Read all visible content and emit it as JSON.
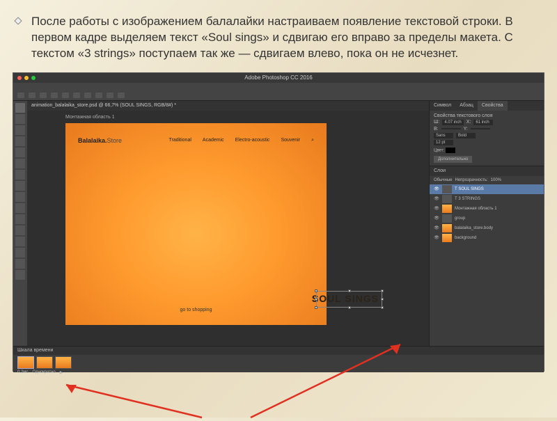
{
  "slide": {
    "bullet_text": "После работы с изображением балалайки настраиваем появление текстовой строки. В первом кадре выделяем текст «Soul sings» и сдвигаю его вправо за пределы макета. С текстом «3 strings» поступаем так же — сдвигаем влево, пока он не исчезнет."
  },
  "photoshop": {
    "title": "Adobe Photoshop CC 2016",
    "document_tab": "animation_balalaika_store.psd @ 66,7% (SOUL SINGS, RGB/8#) *",
    "artboard_label": "Монтажная область 1",
    "canvas": {
      "brand_main": "Balalaika.",
      "brand_sub": "Store",
      "nav": [
        "Traditional",
        "Academic",
        "Electro-acoustic",
        "Souvenir"
      ],
      "cta": "go to shopping",
      "hero_text": "SOUL SINGS"
    },
    "right_panels": {
      "tabs": [
        "Символ",
        "Абзац",
        "Свойства"
      ],
      "active_tab": "Свойства",
      "panel_title": "Свойства текстового слоя",
      "width_label": "Ш:",
      "width_val": "4.07 inch",
      "height_label": "В:",
      "x_label": "X:",
      "x_val": "61 inch",
      "y_label": "Y:",
      "font": "Sans",
      "weight": "Bold",
      "size": "12 pt",
      "btn": "Дополнительно"
    },
    "layers": {
      "title": "Слои",
      "mode": "Обычные",
      "opacity_label": "Непрозрачность:",
      "opacity": "100%",
      "items": [
        {
          "name": "Т SOUL SINGS",
          "selected": true
        },
        {
          "name": "Т 3 STRINGS",
          "selected": false
        },
        {
          "name": "Монтажная область 1",
          "selected": false
        },
        {
          "name": "group",
          "selected": false
        },
        {
          "name": "balalaika_store.body",
          "selected": false
        },
        {
          "name": "background",
          "selected": false
        }
      ]
    },
    "timeline": {
      "title": "Шкала времени",
      "frames": 3,
      "delay": "0,2мс",
      "loop": "Однократно"
    }
  }
}
